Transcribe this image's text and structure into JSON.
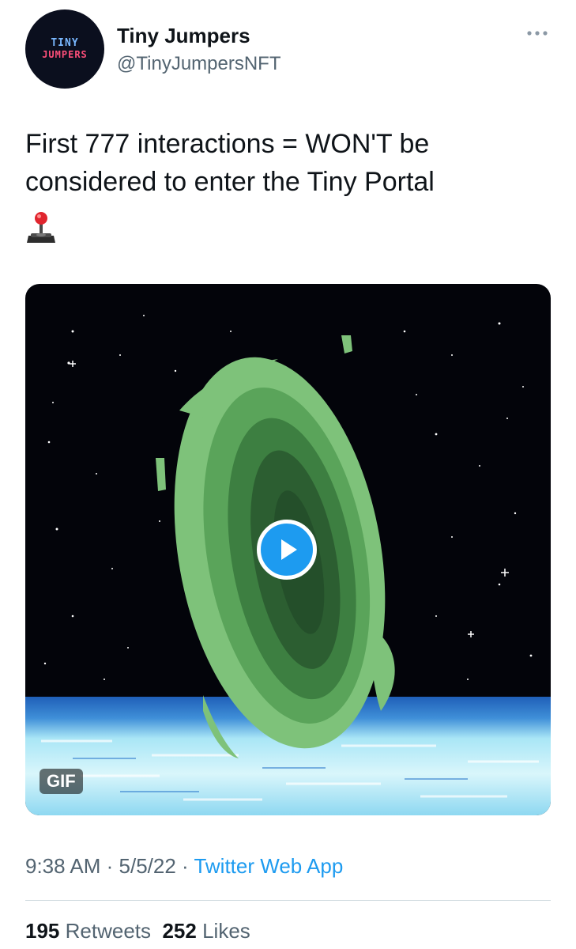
{
  "author": {
    "avatar_line1": "TINY",
    "avatar_line2": "JUMPERS",
    "display_name": "Tiny Jumpers",
    "handle": "@TinyJumpersNFT"
  },
  "tweet": {
    "text_line1": "First 777 interactions = WON'T be",
    "text_line2": "considered to enter the Tiny Portal",
    "emoji": "joystick-emoji"
  },
  "media": {
    "badge": "GIF",
    "play_icon": "play-icon",
    "colors": {
      "space": "#03040a",
      "portal_light": "#7ec27a",
      "portal_mid": "#4f9a4f",
      "portal_dark": "#244f2a",
      "water": "#aeeaf8"
    }
  },
  "meta": {
    "time": "9:38 AM",
    "sep1": " · ",
    "date": "5/5/22",
    "sep2": " · ",
    "source": "Twitter Web App"
  },
  "stats": {
    "retweets_count": "195",
    "retweets_label": "Retweets",
    "likes_count": "252",
    "likes_label": "Likes"
  },
  "icons": {
    "more": "more-horizontal-icon"
  },
  "colors": {
    "accent": "#1d9bf0",
    "text": "#0f1419",
    "secondary": "#536471"
  }
}
